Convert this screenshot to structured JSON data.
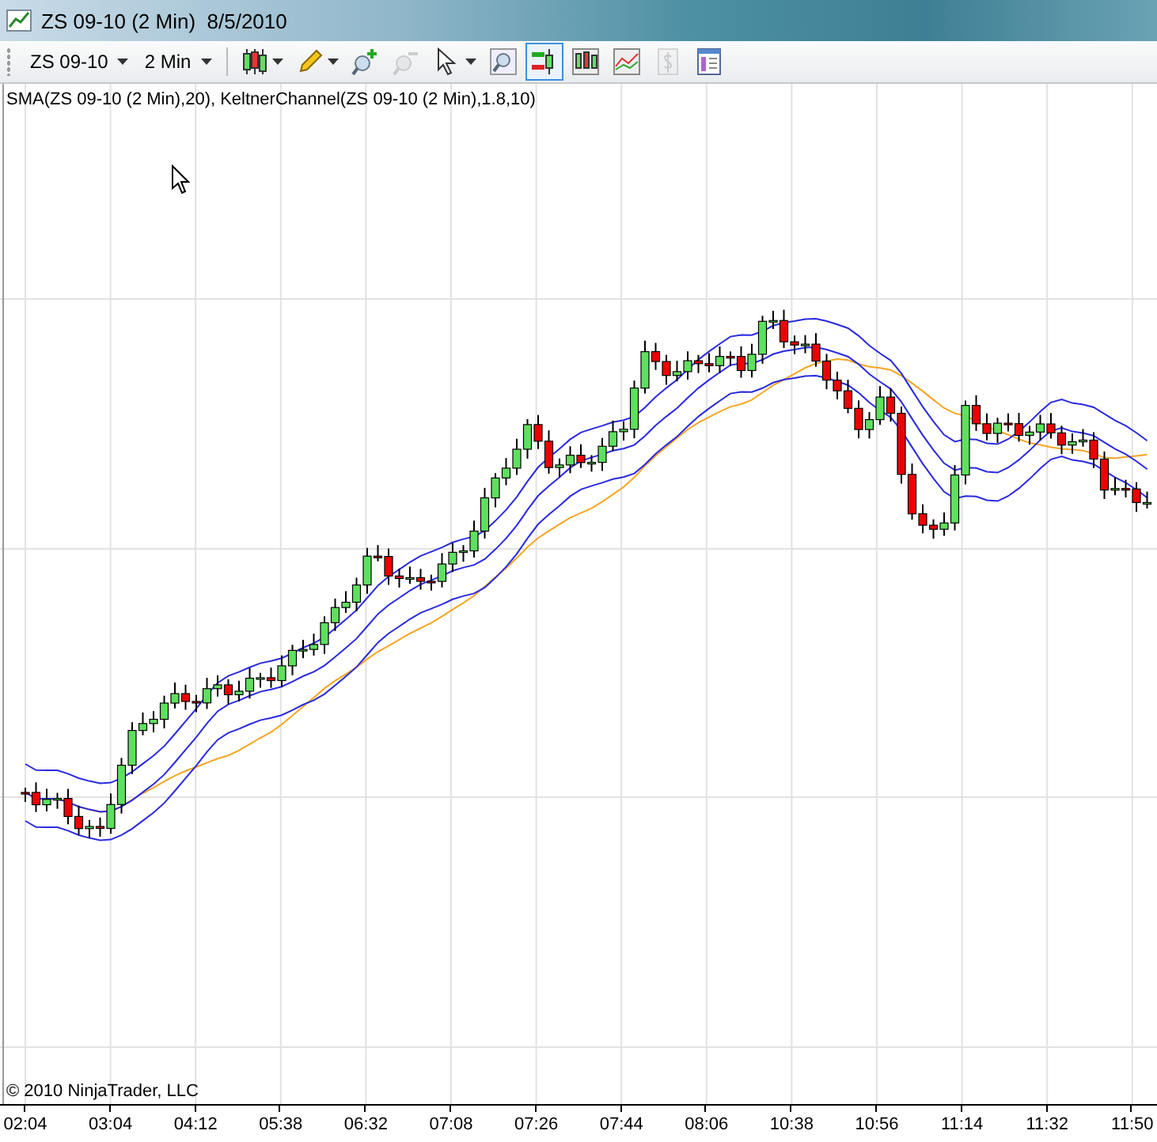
{
  "window": {
    "title": "ZS 09-10 (2 Min)  8/5/2010"
  },
  "toolbar": {
    "instrument": "ZS 09-10",
    "interval": "2 Min",
    "tools": [
      {
        "kind": "candles",
        "menu": true,
        "selected": false,
        "disabled": false
      },
      {
        "kind": "pencil",
        "menu": true,
        "selected": false,
        "disabled": false
      },
      {
        "kind": "zoom-in",
        "menu": false,
        "selected": false,
        "disabled": false
      },
      {
        "kind": "zoom-out",
        "menu": false,
        "selected": false,
        "disabled": true
      },
      {
        "kind": "pointer",
        "menu": true,
        "selected": false,
        "disabled": false
      },
      {
        "kind": "find",
        "menu": false,
        "selected": false,
        "disabled": false
      },
      {
        "kind": "orders",
        "menu": false,
        "selected": true,
        "disabled": false
      },
      {
        "kind": "bars",
        "menu": false,
        "selected": false,
        "disabled": false
      },
      {
        "kind": "line",
        "menu": false,
        "selected": false,
        "disabled": false
      },
      {
        "kind": "dollar",
        "menu": false,
        "selected": false,
        "disabled": true
      },
      {
        "kind": "properties",
        "menu": false,
        "selected": false,
        "disabled": false
      }
    ]
  },
  "chart": {
    "indicators": "SMA(ZS 09-10 (2 Min),20), KeltnerChannel(ZS 09-10 (2 Min),1.8,10)",
    "copyright": "© 2010 NinjaTrader, LLC",
    "x_labels": [
      "02:04",
      "03:04",
      "04:12",
      "05:38",
      "06:32",
      "07:08",
      "07:26",
      "07:44",
      "08:06",
      "10:38",
      "10:56",
      "11:14",
      "11:32",
      "11:50"
    ]
  }
}
